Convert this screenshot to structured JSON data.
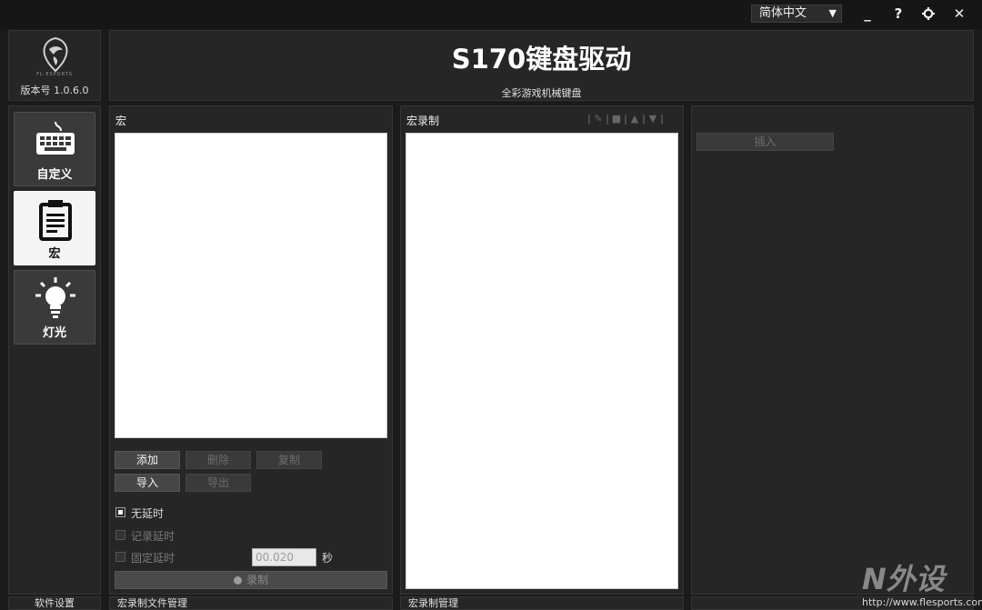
{
  "titlebar": {
    "language": "简体中文",
    "buttons": {
      "minimize": "_",
      "help": "?",
      "settings": "⚙",
      "close": "✕"
    }
  },
  "logo": {
    "brand_small": "FL·ESPORTS",
    "version": "版本号 1.0.6.0"
  },
  "header": {
    "title": "S170键盘驱动",
    "subtitle": "全彩游戏机械键盘"
  },
  "nav": [
    {
      "label": "自定义",
      "icon": "keyboard-icon",
      "active": false
    },
    {
      "label": "宏",
      "icon": "clipboard-icon",
      "active": true
    },
    {
      "label": "灯光",
      "icon": "lightbulb-icon",
      "active": false
    }
  ],
  "macro_panel": {
    "title": "宏",
    "buttons": {
      "add": "添加",
      "delete": "删除",
      "copy": "复制",
      "import": "导入",
      "export": "导出"
    },
    "options": {
      "no_delay": "无延时",
      "record_delay": "记录延时",
      "fixed_delay": "固定延时"
    },
    "delay_value": "00.020",
    "delay_unit": "秒",
    "record": "录制"
  },
  "recording_panel": {
    "title": "宏录制"
  },
  "insert_panel": {
    "insert": "插入"
  },
  "footer": {
    "software_settings": "软件设置",
    "macro_file_mgmt": "宏录制文件管理",
    "macro_mgmt": "宏录制管理"
  },
  "watermark": {
    "logo": "N外设",
    "url": "http://www.flesports.com"
  },
  "colors": {
    "background": "#1b1b1b",
    "panel": "#262626",
    "active_nav": "#f4f4f4",
    "button": "#474747"
  }
}
